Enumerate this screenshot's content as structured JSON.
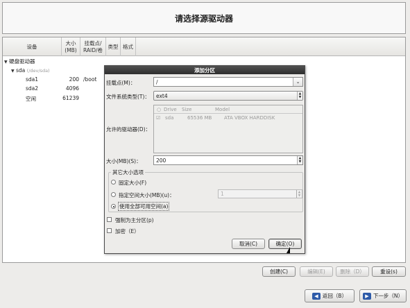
{
  "header": {
    "title": "请选择源驱动器"
  },
  "table": {
    "columns": [
      "设备",
      "大小\n(MB)",
      "挂载点/\nRAID/卷",
      "类型",
      "格式"
    ],
    "root_label": "硬盘驱动器",
    "disk": {
      "name": "sda",
      "path": "(/dev/sda)"
    },
    "partitions": [
      {
        "name": "sda1",
        "size": "200",
        "mount": "/boot"
      },
      {
        "name": "sda2",
        "size": "4096",
        "mount": ""
      },
      {
        "name": "空闲",
        "size": "61239",
        "mount": ""
      }
    ]
  },
  "dialog": {
    "title": "添加分区",
    "mount_label": "挂载点(M)：",
    "mount_value": "/",
    "fstype_label": "文件系统类型(T)：",
    "fstype_value": "ext4",
    "drives_label": "允许的驱动器(D)：",
    "drive_headers": [
      "Drive",
      "Size",
      "Model"
    ],
    "drives": [
      {
        "name": "sda",
        "size": "65536 MB",
        "model": "ATA VBOX HARDDISK",
        "checked": true
      }
    ],
    "size_label": "大小(MB)(S)：",
    "size_value": "200",
    "size_options_legend": "其它大小选项",
    "opt_fixed": "固定大小(F)",
    "opt_upto": "指定空间大小(MB)(u)：",
    "opt_upto_value": "1",
    "opt_fill": "使用全部可用空间(a)",
    "selected_option": "fill",
    "force_primary": "强制为主分区(p)",
    "encrypt": "加密（E）",
    "cancel": "取消(C)",
    "ok": "确定(O)"
  },
  "actions": {
    "create": "创建(C)",
    "edit": "编辑(E)",
    "delete": "删除（D）",
    "reset": "重设(s)"
  },
  "nav": {
    "back": "返回（B）",
    "next": "下一步（N）"
  }
}
